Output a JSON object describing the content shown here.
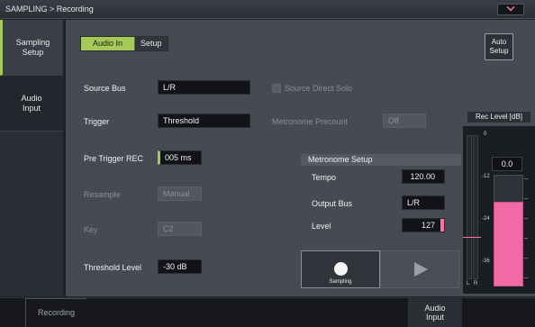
{
  "titlebar": {
    "title": "SAMPLING > Recording"
  },
  "sidebar": {
    "items": [
      {
        "label": "Sampling\nSetup"
      },
      {
        "label": "Audio\nInput"
      }
    ]
  },
  "segment": {
    "audio_in": "Audio In",
    "setup": "Setup"
  },
  "auto_setup": "Auto\nSetup",
  "source_bus": {
    "label": "Source Bus",
    "value": "L/R"
  },
  "source_direct_solo": {
    "label": "Source Direct Solo"
  },
  "trigger": {
    "label": "Trigger",
    "value": "Threshold"
  },
  "metronome_precount": {
    "label": "Metronome Precount",
    "value": "Off"
  },
  "pre_trigger": {
    "label": "Pre Trigger REC",
    "value": "005 ms"
  },
  "resample": {
    "label": "Resample",
    "value": "Manual"
  },
  "key": {
    "label": "Key",
    "value": "C2"
  },
  "threshold": {
    "label": "Threshold Level",
    "value": "-30 dB"
  },
  "metronome_setup": {
    "title": "Metronome Setup",
    "tempo": {
      "label": "Tempo",
      "value": "120.00"
    },
    "output_bus": {
      "label": "Output Bus",
      "value": "L/R"
    },
    "level": {
      "label": "Level",
      "value": "127"
    }
  },
  "transport": {
    "sampling_label": "Sampling"
  },
  "meter": {
    "title": "Rec Level [dB]",
    "value": "0.0",
    "ticks": [
      "0",
      "-12",
      "-24",
      "-36"
    ],
    "l": "L",
    "r": "R",
    "accent_color": "#f06aa6"
  },
  "bottom": {
    "recording": "Recording",
    "audio_input": "Audio\nInput"
  }
}
